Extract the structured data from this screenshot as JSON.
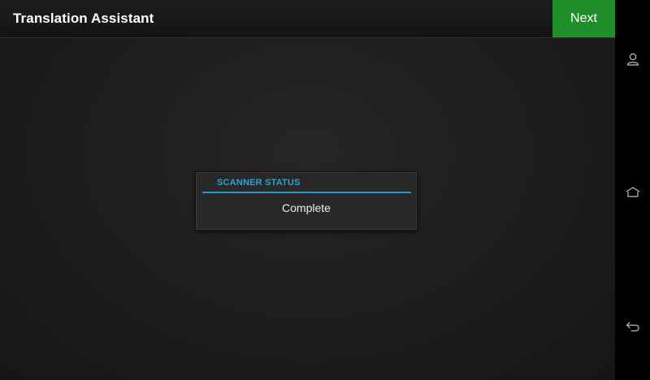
{
  "header": {
    "title": "Translation Assistant",
    "next_label": "Next"
  },
  "dialog": {
    "title": "SCANNER STATUS",
    "message": "Complete"
  },
  "navbar": {
    "icons": [
      "person-icon",
      "home-icon",
      "back-icon"
    ]
  },
  "colors": {
    "accent_blue": "#29a3d9",
    "next_green": "#1f8f2a",
    "background": "#1c1c1c"
  }
}
